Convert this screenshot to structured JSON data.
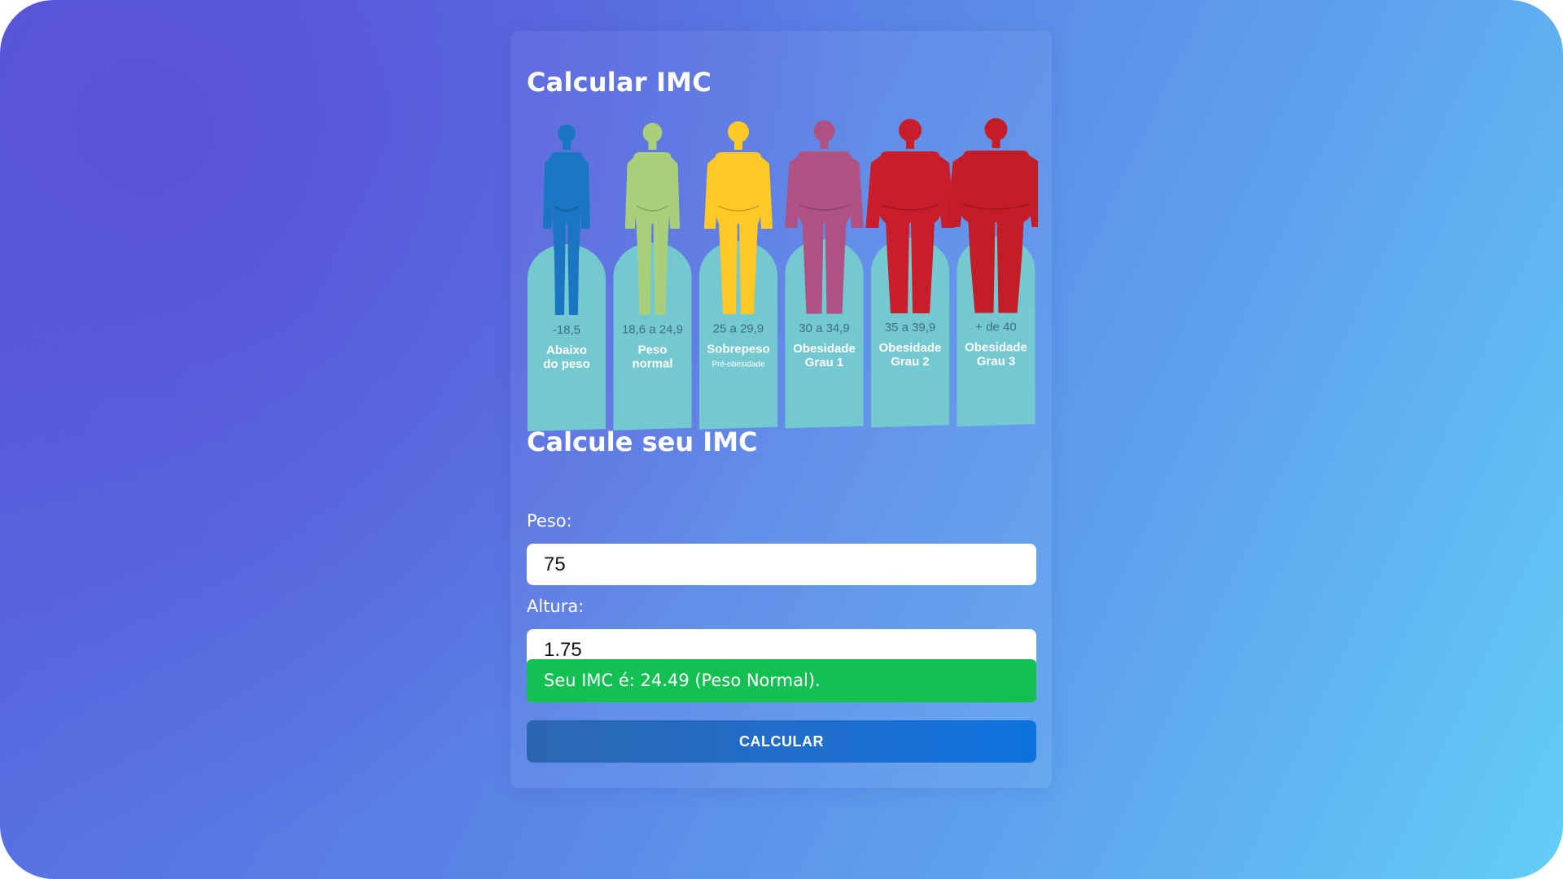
{
  "page": {
    "title": "Calcular IMC",
    "form_title": "Calcule seu IMC"
  },
  "chart": {
    "categories": [
      {
        "range": "-18,5",
        "name_line1": "Abaixo",
        "name_line2": "do peso",
        "note": "",
        "color": "#1a76c2"
      },
      {
        "range": "18,6 a 24,9",
        "name_line1": "Peso",
        "name_line2": "normal",
        "note": "",
        "color": "#a8d07a"
      },
      {
        "range": "25 a 29,9",
        "name_line1": "Sobrepeso",
        "name_line2": "",
        "note": "Pré-obesidade",
        "color": "#fcc926"
      },
      {
        "range": "30 a 34,9",
        "name_line1": "Obesidade",
        "name_line2": "Grau 1",
        "note": "",
        "color": "#ae5283"
      },
      {
        "range": "35 a 39,9",
        "name_line1": "Obesidade",
        "name_line2": "Grau 2",
        "note": "",
        "color": "#c81e2c"
      },
      {
        "range": "+ de 40",
        "name_line1": "Obesidade",
        "name_line2": "Grau 3",
        "note": "",
        "color": "#c31d27"
      }
    ],
    "tombstone_color": "#74c8d0",
    "range_text_color": "#3e6f80"
  },
  "form": {
    "peso_label": "Peso:",
    "peso_value": "75",
    "altura_label": "Altura:",
    "altura_value": "1.75"
  },
  "result": {
    "text": "Seu IMC é: 24.49 (Peso Normal).",
    "color": "#13c152"
  },
  "button": {
    "label": "CALCULAR"
  }
}
